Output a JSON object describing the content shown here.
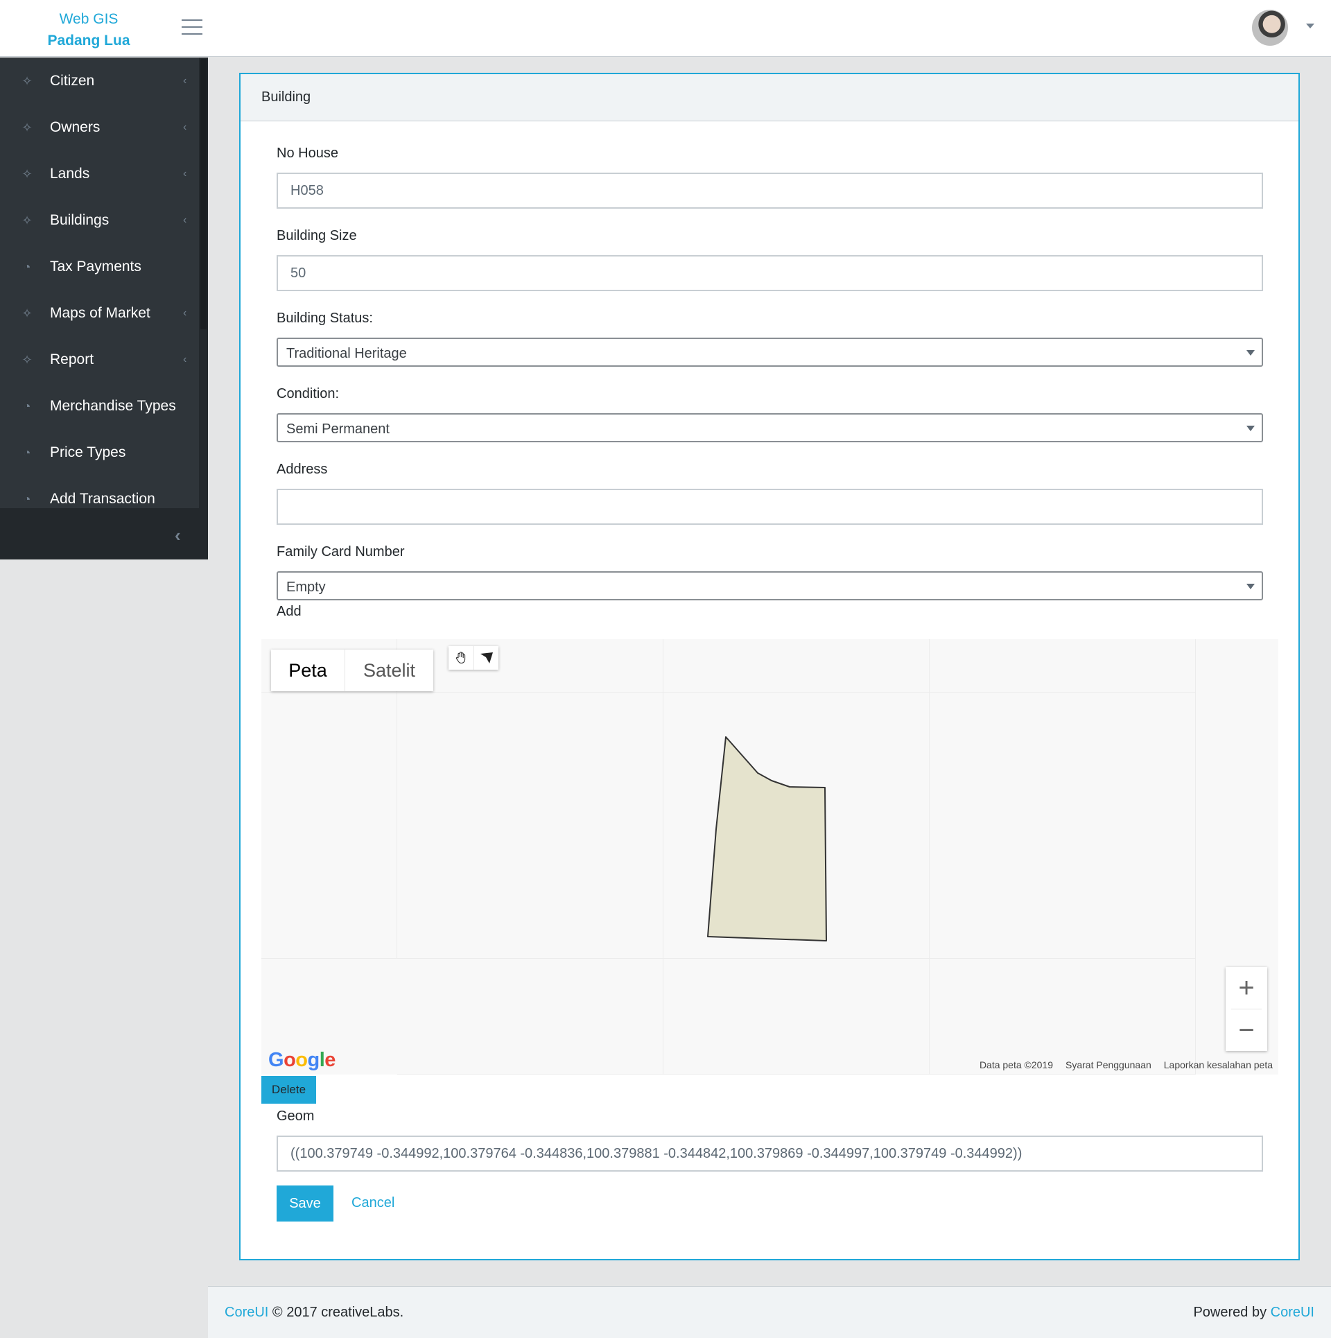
{
  "brand": {
    "line1": "Web GIS",
    "line2": "Padang Lua"
  },
  "sidebar": {
    "items": [
      {
        "label": "Citizen",
        "icon": "puzzle-icon",
        "has_children": true
      },
      {
        "label": "Owners",
        "icon": "puzzle-icon",
        "has_children": true
      },
      {
        "label": "Lands",
        "icon": "puzzle-icon",
        "has_children": true
      },
      {
        "label": "Buildings",
        "icon": "puzzle-icon",
        "has_children": true
      },
      {
        "label": "Tax Payments",
        "icon": "speedometer-icon",
        "has_children": false
      },
      {
        "label": "Maps of Market",
        "icon": "puzzle-icon",
        "has_children": true
      },
      {
        "label": "Report",
        "icon": "puzzle-icon",
        "has_children": true
      },
      {
        "label": "Merchandise Types",
        "icon": "speedometer-icon",
        "has_children": false
      },
      {
        "label": "Price Types",
        "icon": "speedometer-icon",
        "has_children": false
      },
      {
        "label": "Add Transaction",
        "icon": "speedometer-icon",
        "has_children": false
      }
    ]
  },
  "card": {
    "title": "Building"
  },
  "form": {
    "no_house": {
      "label": "No House",
      "value": "H058"
    },
    "building_size": {
      "label": "Building Size",
      "value": "50"
    },
    "building_status": {
      "label": "Building Status:",
      "value": "Traditional Heritage"
    },
    "condition": {
      "label": "Condition:",
      "value": "Semi Permanent"
    },
    "address": {
      "label": "Address",
      "value": ""
    },
    "family_card": {
      "label": "Family Card Number",
      "value": "Empty"
    },
    "add_label": "Add",
    "geom": {
      "label": "Geom",
      "value": "((100.379749 -0.344992,100.379764 -0.344836,100.379881 -0.344842,100.379869 -0.344997,100.379749 -0.344992))"
    },
    "save_label": "Save",
    "cancel_label": "Cancel"
  },
  "map": {
    "type_map": "Peta",
    "type_satellite": "Satelit",
    "zoom_in": "+",
    "zoom_out": "−",
    "delete_label": "Delete",
    "footer": {
      "data": "Data peta ©2019",
      "terms": "Syarat Penggunaan",
      "report": "Laporkan kesalahan peta"
    },
    "polygon_fill": "#e5e3cd",
    "polygon_stroke": "#333333"
  },
  "footer": {
    "left_link": "CoreUI",
    "left_text": "© 2017 creativeLabs.",
    "right_text": "Powered by",
    "right_link": "CoreUI"
  },
  "colors": {
    "accent": "#20a8d8",
    "sidebar": "#2f353a"
  }
}
